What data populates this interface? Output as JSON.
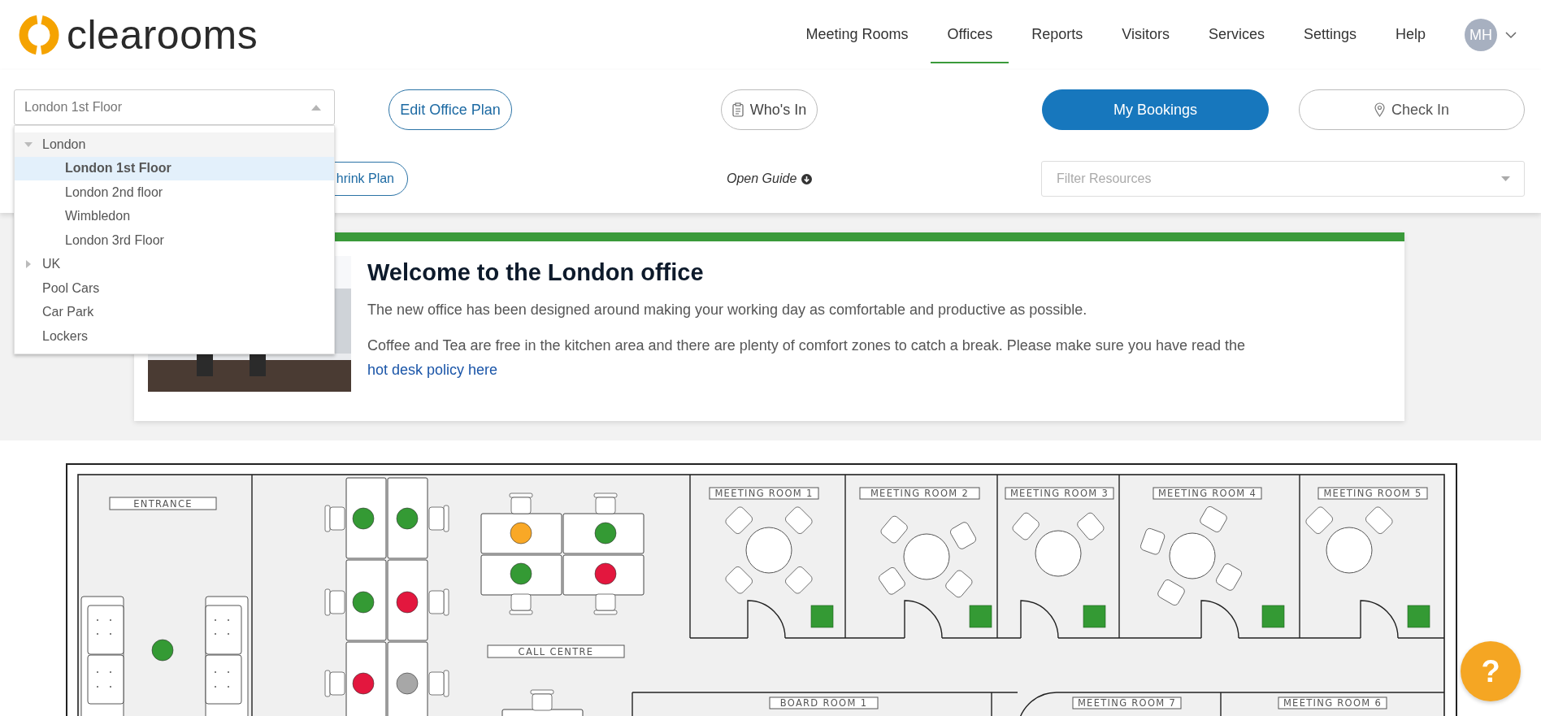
{
  "header": {
    "logo": "clearooms",
    "nav": [
      {
        "label": "Meeting Rooms",
        "selected": false
      },
      {
        "label": "Offices",
        "selected": true
      },
      {
        "label": "Reports",
        "selected": false
      },
      {
        "label": "Visitors",
        "selected": false
      },
      {
        "label": "Services",
        "selected": false
      },
      {
        "label": "Settings",
        "selected": false
      },
      {
        "label": "Help",
        "selected": false
      }
    ],
    "avatar": "MH"
  },
  "toolbar": {
    "location_select": {
      "value": "London 1st Floor",
      "open": true
    },
    "location_tree": [
      {
        "label": "London",
        "expanded": true,
        "selected": false,
        "children": [
          {
            "label": "London 1st Floor",
            "selected": true
          },
          {
            "label": "London 2nd floor",
            "selected": false
          },
          {
            "label": "Wimbledon",
            "selected": false
          },
          {
            "label": "London 3rd Floor",
            "selected": false
          }
        ]
      },
      {
        "label": "UK",
        "expanded": false,
        "selected": false
      },
      {
        "label": "Pool Cars",
        "selected": false
      },
      {
        "label": "Car Park",
        "selected": false
      },
      {
        "label": "Lockers",
        "selected": false
      }
    ],
    "actions": [
      {
        "label": "Edit Office Plan",
        "kind": "outline"
      },
      {
        "label": "Who's In",
        "kind": "clipboard"
      },
      {
        "label": "My Bookings",
        "kind": "primary"
      },
      {
        "label": "Check In",
        "kind": "pin"
      }
    ],
    "shrink_button": "hrink Plan",
    "guide_link": "Open Guide",
    "filter": {
      "placeholder": "Filter Resources"
    }
  },
  "welcome": {
    "title": "Welcome to the London office",
    "paragraphs": [
      {
        "text": "The new office has been designed around making your working day as comfortable and productive as possible."
      },
      {
        "text": "Coffee and Tea are free in the kitchen area and there are plenty of comfort zones to catch a break. Please make sure you have read the ",
        "link": "hot desk policy here"
      }
    ]
  },
  "floor_plan": {
    "areas": [
      {
        "label": "ENTRANCE"
      },
      {
        "label": "CALL CENTRE"
      }
    ],
    "desks": [
      {
        "color": "#349a34"
      },
      {
        "color": "#349a34"
      },
      {
        "color": "#349a34"
      },
      {
        "color": "#e3173e"
      },
      {
        "color": "#e3173e"
      },
      {
        "color": "#a7a7a7"
      },
      {
        "color": "#f9a826"
      },
      {
        "color": "#349a34"
      },
      {
        "color": "#349a34"
      },
      {
        "color": "#e3173e"
      },
      {
        "color": "#349a34"
      }
    ],
    "rooms": [
      {
        "label": "MEETING ROOM 1",
        "color": "#349a34"
      },
      {
        "label": "MEETING ROOM 2",
        "color": "#349a34"
      },
      {
        "label": "MEETING ROOM 3",
        "color": "#349a34"
      },
      {
        "label": "MEETING ROOM 4",
        "color": "#349a34"
      },
      {
        "label": "MEETING ROOM 5",
        "color": "#349a34"
      }
    ],
    "lower_rooms": [
      {
        "label": "BOARD ROOM 1"
      },
      {
        "label": "MEETING ROOM 7"
      },
      {
        "label": "MEETING ROOM 6"
      }
    ]
  },
  "help_button": "?"
}
